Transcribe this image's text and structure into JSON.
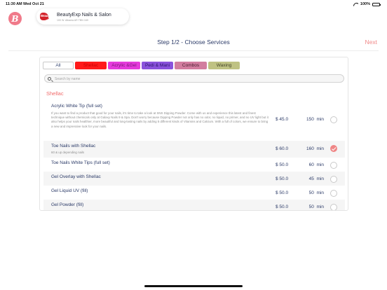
{
  "status_bar": {
    "time": "11:30 AM",
    "date": "Wed Oct 21",
    "battery": "100%"
  },
  "app": {
    "logo_letter": "B",
    "page_title": "Step 1/2 - Choose Services",
    "next_label": "Next"
  },
  "salon": {
    "logo_text": "BeautyExp",
    "logo_sub": "EXP",
    "name": "BeautyExp Nails & Salon",
    "address": "100 W. Albania AR TBN 169"
  },
  "categories": [
    {
      "label": "All",
      "color": "#ffffff"
    },
    {
      "label": "Shellac",
      "color": "#ff1a1a"
    },
    {
      "label": "Acrylic &Gel",
      "color": "#e53bdc"
    },
    {
      "label": "Pedi & Mani",
      "color": "#8a52dc"
    },
    {
      "label": "Combos",
      "color": "#d27d9f"
    },
    {
      "label": "Waxing",
      "color": "#bfc283"
    }
  ],
  "search": {
    "placeholder": "Search by name",
    "value": ""
  },
  "section": {
    "title": "Shellac"
  },
  "services": [
    {
      "name": "Acrylic White Tip (full set)",
      "description": "If you want to find a product that good for your nails, it's time to take a look at SNS Dipping Powder. Come with us and experience this latest and finest technique without chemicals only at Galaxy Nails 9 & Spa. Don't worry because Dipping Powder not only has no odor, no liquid, no primer, and no UV light but it also helps your nails healthier, more beautiful and long-lasting nails by adding 5 different kinds of Vitamins and Calcium. With a full of colors, we ensure to bring a new and impressive look for your nails.",
      "price": "$ 45.0",
      "duration": "150",
      "unit": "min",
      "selected": false
    },
    {
      "name": "Toe Nails with Shellac",
      "description": "60 & up depending nails",
      "price": "$ 60.0",
      "duration": "160",
      "unit": "min",
      "selected": true
    },
    {
      "name": "Toe Nails White Tips (full set)",
      "description": "",
      "price": "$ 50.0",
      "duration": "60",
      "unit": "min",
      "selected": false
    },
    {
      "name": "Gel Overlay with Shellac",
      "description": "",
      "price": "$ 50.0",
      "duration": "45",
      "unit": "min",
      "selected": false
    },
    {
      "name": "Gel Liquid UV (fill)",
      "description": "",
      "price": "$ 50.0",
      "duration": "50",
      "unit": "min",
      "selected": false
    },
    {
      "name": "Gel Powder (fill)",
      "description": "",
      "price": "$ 50.0",
      "duration": "50",
      "unit": "min",
      "selected": false
    }
  ]
}
